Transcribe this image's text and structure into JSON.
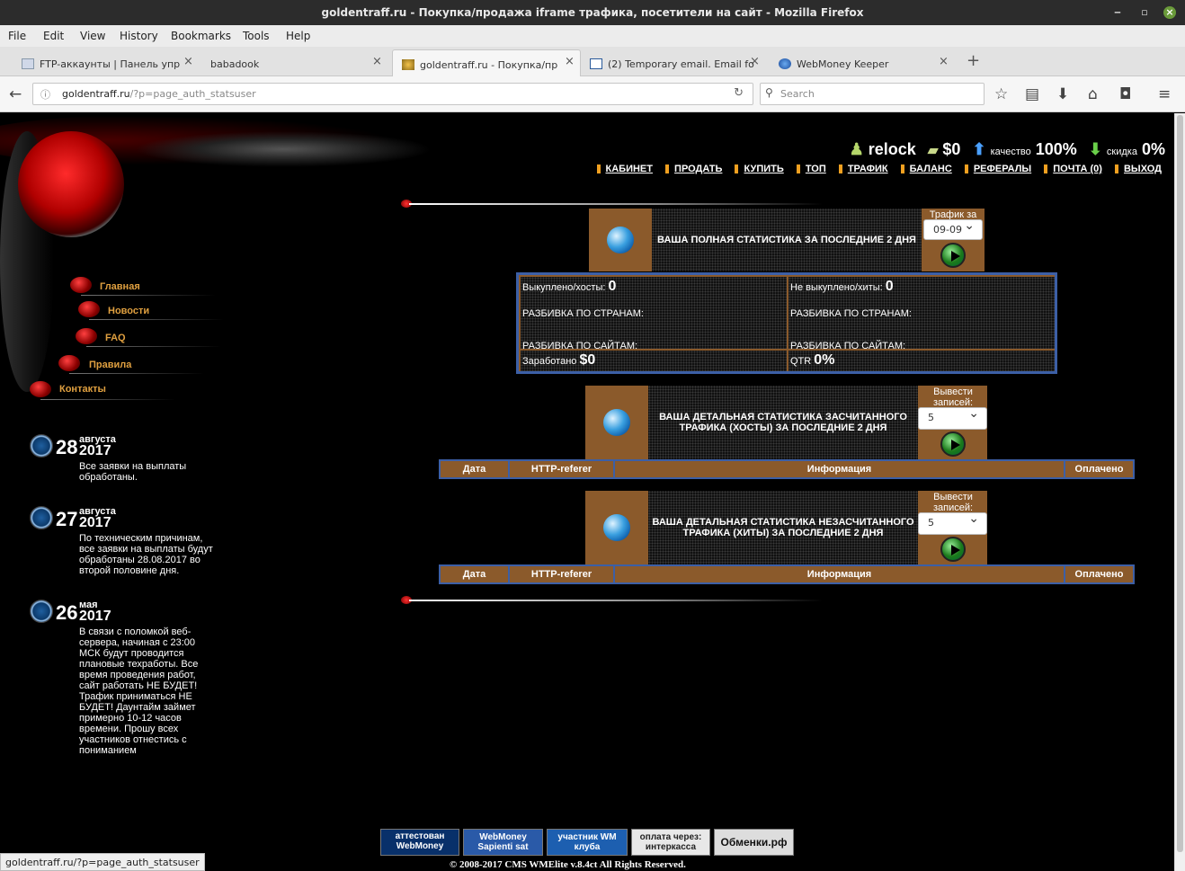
{
  "window": {
    "title": "goldentraff.ru - Покупка/продажа iframe трафика, посетители на сайт - Mozilla Firefox"
  },
  "menu": [
    "File",
    "Edit",
    "View",
    "History",
    "Bookmarks",
    "Tools",
    "Help"
  ],
  "tabs": [
    {
      "label": "FTP-аккаунты | Панель упр"
    },
    {
      "label": "babadook"
    },
    {
      "label": "goldentraff.ru - Покупка/пр"
    },
    {
      "label": "(2) Temporary email. Email fo"
    },
    {
      "label": "WebMoney Keeper"
    }
  ],
  "urlbar": {
    "url_host": "goldentraff.ru",
    "url_path": "/?p=page_auth_statsuser"
  },
  "search": {
    "placeholder": "Search"
  },
  "status_url": "goldentraff.ru/?p=page_auth_statsuser",
  "user": {
    "name": "relock",
    "balance": "$0",
    "quality_label": "качество",
    "quality": "100%",
    "discount_label": "скидка",
    "discount": "0%"
  },
  "topnav": [
    "КАБИНЕТ",
    "ПРОДАТЬ",
    "КУПИТЬ",
    "ТОП",
    "ТРАФИК",
    "БАЛАНС",
    "РЕФЕРАЛЫ",
    "ПОЧТА (0)",
    "ВЫХОД"
  ],
  "leftnav": [
    "Главная",
    "Новости",
    "FAQ",
    "Правила",
    "Контакты"
  ],
  "news": [
    {
      "day": "28",
      "month": "августа",
      "year": "2017",
      "text": "Все заявки на выплаты обработаны."
    },
    {
      "day": "27",
      "month": "августа",
      "year": "2017",
      "text": "По техническим причинам, все заявки на выплаты будут обработаны 28.08.2017 во второй половине дня."
    },
    {
      "day": "26",
      "month": "мая",
      "year": "2017",
      "text": "В связи с поломкой веб-сервера, начиная с 23:00 МСК будут проводится плановые техработы. Все время проведения работ, сайт работать НЕ БУДЕТ! Трафик приниматься НЕ БУДЕТ! Даунтайм займет примерно 10-12 часов времени. Прошу всех участников отнестись с пониманием"
    }
  ],
  "full_stats": {
    "title": "ВАША ПОЛНАЯ СТАТИСТИКА ЗА ПОСЛЕДНИЕ 2 ДНЯ",
    "select_label": "Трафик за",
    "select_value": "09-09",
    "bought_label": "Выкуплено/хосты:",
    "bought_value": "0",
    "notbought_label": "Не выкуплено/хиты:",
    "notbought_value": "0",
    "by_country": "РАЗБИВКА ПО СТРАНАМ:",
    "by_site": "РАЗБИВКА ПО САЙТАМ:",
    "earned_label": "Заработано",
    "earned_value": "$0",
    "qtr_label": "QTR",
    "qtr_value": "0%"
  },
  "hosts_stats": {
    "title": "ВАША ДЕТАЛЬНАЯ СТАТИСТИКА ЗАСЧИТАННОГО ТРАФИКА (ХОСТЫ) ЗА ПОСЛЕДНИЕ 2 ДНЯ",
    "select_label": "Вывести записей:",
    "select_value": "5",
    "columns": [
      "Дата",
      "HTTP-referer",
      "Информация",
      "Оплачено"
    ]
  },
  "hits_stats": {
    "title": "ВАША ДЕТАЛЬНАЯ СТАТИСТИКА НЕЗАСЧИТАННОГО ТРАФИКА (ХИТЫ) ЗА ПОСЛЕДНИЕ 2 ДНЯ",
    "select_label": "Вывести записей:",
    "select_value": "5",
    "columns": [
      "Дата",
      "HTTP-referer",
      "Информация",
      "Оплачено"
    ]
  },
  "footer": {
    "banners": [
      "аттестован WebMoney",
      "WebMoney Sapienti sat",
      "участник WM клуба",
      "оплата через: интеркасса",
      "Обменки.рф"
    ],
    "copyright": "© 2008-2017 CMS WMElite v.8.4ct All Rights Reserved."
  },
  "colors": {
    "accent_brown": "#8b5a2b",
    "border_blue": "#3c5fa6",
    "link_orange": "#e0a040"
  }
}
